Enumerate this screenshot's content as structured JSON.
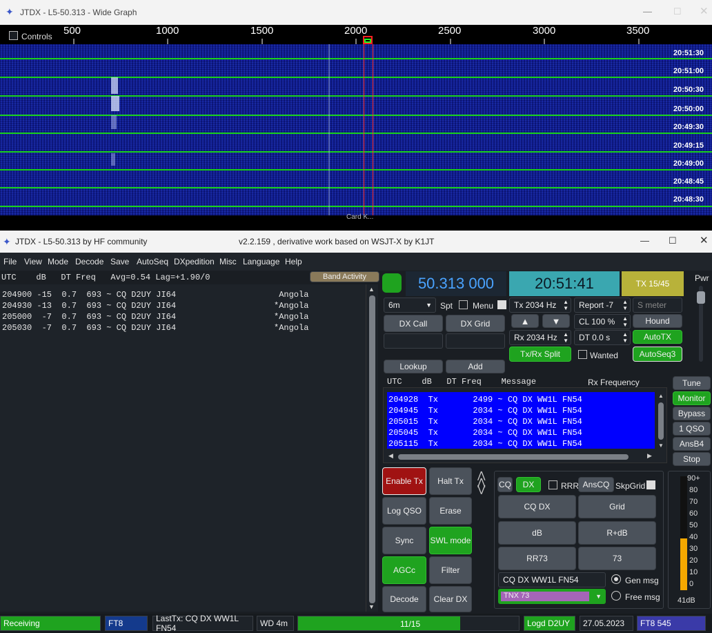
{
  "wide_graph": {
    "title": "JTDX - L5-50.313 - Wide Graph",
    "controls_label": "Controls",
    "freq_ticks": [
      "500",
      "1000",
      "1500",
      "2000",
      "2500",
      "3000",
      "3500"
    ],
    "timestamps": [
      "20:51:30",
      "20:51:00",
      "20:50:30",
      "20:50:00",
      "20:49:30",
      "20:49:15",
      "20:49:00",
      "20:48:45",
      "20:48:30"
    ],
    "bottom_text": "Card K..."
  },
  "main": {
    "title": "JTDX - L5-50.313  by HF community",
    "version": "v2.2.159 , derivative work based on WSJT-X by K1JT"
  },
  "menu": [
    "File",
    "View",
    "Mode",
    "Decode",
    "Save",
    "AutoSeq",
    "DXpedition",
    "Misc",
    "Language",
    "Help"
  ],
  "band_header": {
    "text": "UTC    dB   DT Freq   Avg=0.54 Lag=+1.90/0",
    "band_activity": "Band Activity"
  },
  "decodes": [
    {
      "line": "204900 -15  0.7  693 ~ CQ D2UY JI64",
      "country": " Angola"
    },
    {
      "line": "204930 -13  0.7  693 ~ CQ D2UY JI64",
      "country": "*Angola"
    },
    {
      "line": "205000  -7  0.7  693 ~ CQ D2UY JI64",
      "country": "*Angola"
    },
    {
      "line": "205030  -7  0.7  693 ~ CQ D2UY JI64",
      "country": "*Angola"
    }
  ],
  "controls": {
    "frequency": "50.313 000",
    "clock": "20:51:41",
    "tx_period": "TX 15/45",
    "pwr": "Pwr",
    "band": "6m",
    "spt": "Spt",
    "menu": "Menu",
    "dx_call": "DX Call",
    "dx_grid": "DX Grid",
    "lookup": "Lookup",
    "add": "Add",
    "tx_freq": "Tx  2034 Hz",
    "rx_freq": "Rx  2034 Hz",
    "report": "Report -7",
    "s_meter": "S meter",
    "cl": "CL  100 %",
    "hound": "Hound",
    "dt": "DT 0.0 s",
    "autotx": "AutoTX",
    "txrx_split": "Tx/Rx Split",
    "wanted": "Wanted",
    "autoseq3": "AutoSeq3"
  },
  "rx_header": {
    "text": "UTC    dB   DT Freq    Message",
    "rx_freq_label": "Rx Frequency"
  },
  "rx_messages": [
    "204928  Tx       2499 ~ CQ DX WW1L FN54",
    "204945  Tx       2034 ~ CQ DX WW1L FN54",
    "205015  Tx       2034 ~ CQ DX WW1L FN54",
    "205045  Tx       2034 ~ CQ DX WW1L FN54",
    "205115  Tx       2034 ~ CQ DX WW1L FN54"
  ],
  "side_buttons": [
    "Tune",
    "Monitor",
    "Bypass",
    "1 QSO",
    "AnsB4",
    "Stop"
  ],
  "action_buttons": {
    "enable_tx": "Enable Tx",
    "halt_tx": "Halt Tx",
    "log_qso": "Log QSO",
    "erase": "Erase",
    "sync": "Sync",
    "swl_mode": "SWL mode",
    "agcc": "AGCc",
    "filter": "Filter",
    "decode": "Decode",
    "clear_dx": "Clear DX"
  },
  "tx_panel": {
    "cq": "CQ",
    "dx": "DX",
    "rrr": "RRR",
    "anscq": "AnsCQ",
    "skpgrid": "SkpGrid",
    "cq_dx": "CQ DX",
    "grid": "Grid",
    "db": "dB",
    "r_db": "R+dB",
    "rr73": "RR73",
    "n73": "73",
    "gen_msg_text": "CQ DX WW1L FN54",
    "gen_msg": "Gen msg",
    "free_msg_text": "TNX 73",
    "free_msg": "Free msg"
  },
  "meter": {
    "labels": [
      "90+",
      "80",
      "70",
      "60",
      "50",
      "40",
      "30",
      "20",
      "10",
      "0"
    ],
    "value_db": 41,
    "readout": "41dB"
  },
  "status": {
    "receiving": "Receiving",
    "mode": "FT8",
    "last_tx": "LastTx: CQ DX WW1L FN54",
    "wd": "WD 4m",
    "progress_text": "11/15",
    "progress_fraction": 0.733,
    "logd": "Logd D2UY",
    "date": "27.05.2023",
    "mode_count": "FT8  545"
  },
  "colors": {
    "green": "#1fa31f",
    "red": "#a01212",
    "blue_msg": "#0000ff",
    "freq_text": "#4aa3ff",
    "clock_bg": "#3aa7b0",
    "tx_period_bg": "#b8b23a"
  }
}
